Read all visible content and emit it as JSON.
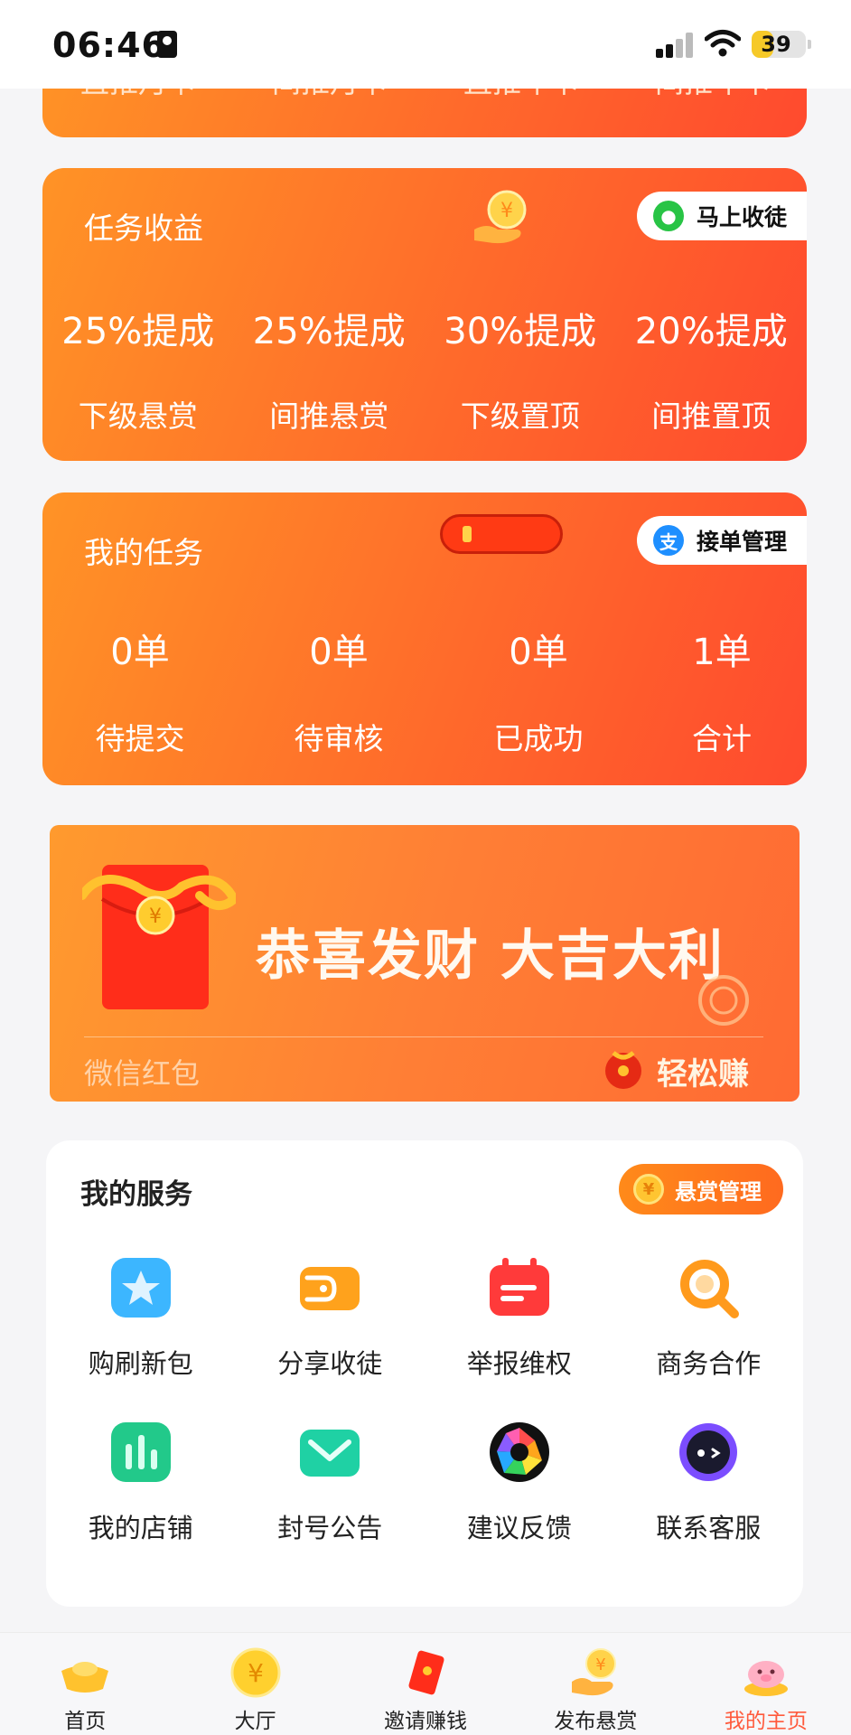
{
  "status_bar": {
    "time": "06:46",
    "battery": "39"
  },
  "top_card": {
    "cut_labels": [
      "直推月卡",
      "间推月卡",
      "直推年卡",
      "间推年卡"
    ]
  },
  "income_card": {
    "title": "任务收益",
    "action_label": "马上收徒",
    "metrics": [
      {
        "value": "25%提成",
        "label": "下级悬赏"
      },
      {
        "value": "25%提成",
        "label": "间推悬赏"
      },
      {
        "value": "30%提成",
        "label": "下级置顶"
      },
      {
        "value": "20%提成",
        "label": "间推置顶"
      }
    ]
  },
  "tasks_card": {
    "title": "我的任务",
    "action_label": "接单管理",
    "metrics": [
      {
        "value": "0单",
        "label": "待提交"
      },
      {
        "value": "0单",
        "label": "待审核"
      },
      {
        "value": "0单",
        "label": "已成功"
      },
      {
        "value": "1单",
        "label": "合计"
      }
    ]
  },
  "banner": {
    "headline": "恭喜发财  大吉大利",
    "subtitle": "微信红包",
    "easy_label": "轻松赚"
  },
  "services": {
    "title": "我的服务",
    "reward_label": "悬赏管理",
    "items": [
      {
        "label": "购刷新包",
        "icon": "star-bag-icon"
      },
      {
        "label": "分享收徒",
        "icon": "wallet-icon"
      },
      {
        "label": "举报维权",
        "icon": "calendar-icon"
      },
      {
        "label": "商务合作",
        "icon": "search-icon"
      },
      {
        "label": "我的店铺",
        "icon": "chart-icon"
      },
      {
        "label": "封号公告",
        "icon": "mail-icon"
      },
      {
        "label": "建议反馈",
        "icon": "aperture-icon"
      },
      {
        "label": "联系客服",
        "icon": "chat-face-icon"
      }
    ]
  },
  "tabbar": {
    "items": [
      {
        "label": "首页",
        "icon": "gold-ingot-icon"
      },
      {
        "label": "大厅",
        "icon": "yen-coin-icon"
      },
      {
        "label": "邀请赚钱",
        "icon": "red-envelope-icon"
      },
      {
        "label": "发布悬赏",
        "icon": "hand-coin-icon"
      },
      {
        "label": "我的主页",
        "icon": "piggy-bank-icon"
      }
    ],
    "active_index": 4
  },
  "colors": {
    "accent": "#ff6a2b",
    "active_tab": "#ff5a3c"
  }
}
